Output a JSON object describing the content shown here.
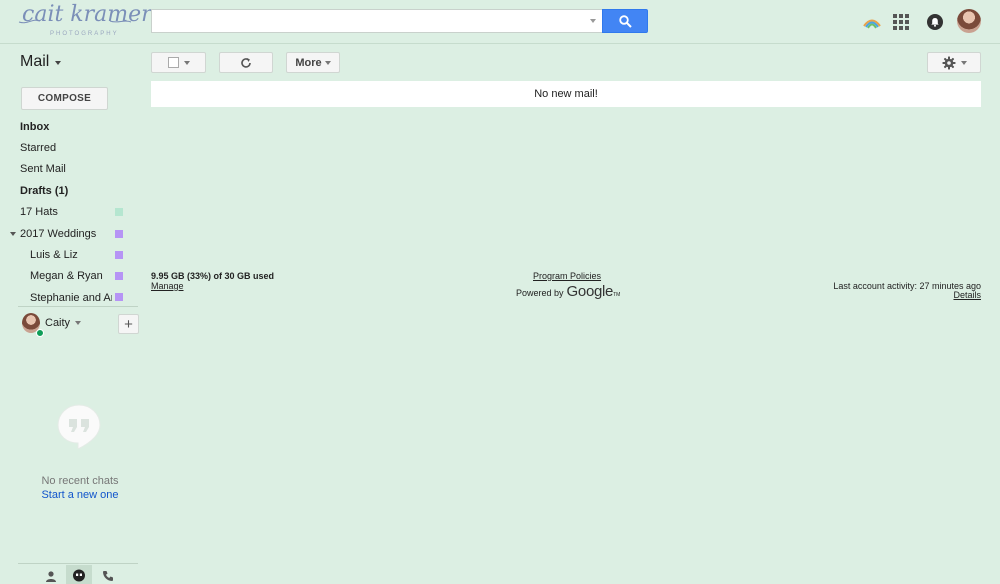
{
  "header": {
    "logo": {
      "script_text": "cait kramer",
      "sub_text": "PHOTOGRAPHY"
    },
    "search": {
      "value": "",
      "placeholder": ""
    },
    "icons": [
      "prism-logo-icon",
      "apps-grid-icon",
      "notifications-icon",
      "avatar"
    ]
  },
  "toolbar": {
    "mail_label": "Mail",
    "more_label": "More"
  },
  "nav": {
    "compose_label": "COMPOSE",
    "items": [
      {
        "label": "Inbox",
        "bold": true
      },
      {
        "label": "Starred"
      },
      {
        "label": "Sent Mail"
      },
      {
        "label": "Drafts (1)",
        "bold": true
      },
      {
        "label": "17 Hats",
        "color": "#b5e6d0"
      },
      {
        "label": "2017 Weddings",
        "color": "#b694f5",
        "expanded": true
      },
      {
        "label": "Luis & Liz",
        "color": "#b694f5"
      },
      {
        "label": "Megan & Ryan",
        "color": "#b694f5"
      },
      {
        "label": "Stephanie and An...",
        "color": "#b694f5"
      }
    ]
  },
  "hangouts": {
    "user_name": "Caity",
    "no_chats_text": "No recent chats",
    "start_new_text": "Start a new one"
  },
  "main": {
    "notice": "No new mail!",
    "storage_text": "9.95 GB (33%) of 30 GB used",
    "storage_used_fraction": 0.33,
    "manage_text": "Manage",
    "policies_text": "Program Policies",
    "powered_text": "Powered by",
    "google_text": "Google",
    "activity_text": "Last account activity: 27 minutes ago",
    "details_text": "Details"
  },
  "colors": {
    "background": "#dcefe3",
    "search_blue": "#4285f4",
    "link_blue": "#1155cc",
    "online_green": "#0f9d58"
  }
}
